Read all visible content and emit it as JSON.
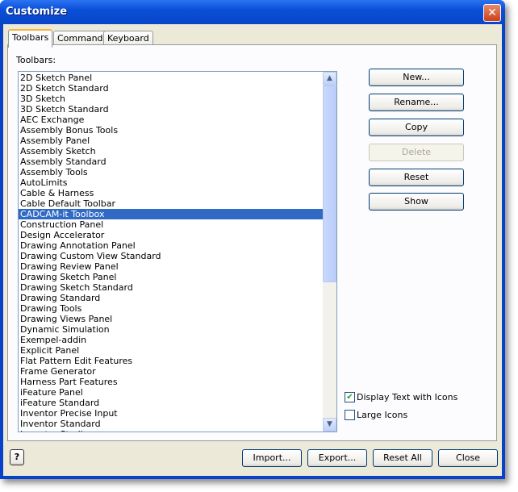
{
  "window": {
    "title": "Customize",
    "close_icon": "close-icon"
  },
  "tabs": [
    {
      "label": "Toolbars"
    },
    {
      "label": "Commands"
    },
    {
      "label": "Keyboard"
    }
  ],
  "list_label": "Toolbars:",
  "toolbars": [
    "2D Sketch Panel",
    "2D Sketch Standard",
    "3D Sketch",
    "3D Sketch Standard",
    "AEC Exchange",
    "Assembly Bonus Tools",
    "Assembly Panel",
    "Assembly Sketch",
    "Assembly Standard",
    "Assembly Tools",
    "AutoLimits",
    "Cable & Harness",
    "Cable Default Toolbar",
    "CADCAM-it Toolbox",
    "Construction Panel",
    "Design Accelerator",
    "Drawing Annotation Panel",
    "Drawing Custom View Standard",
    "Drawing Review Panel",
    "Drawing Sketch Panel",
    "Drawing Sketch Standard",
    "Drawing Standard",
    "Drawing Tools",
    "Drawing Views Panel",
    "Dynamic Simulation",
    "Exempel-addin",
    "Explicit Panel",
    "Flat Pattern Edit Features",
    "Frame Generator",
    "Harness Part Features",
    "iFeature Panel",
    "iFeature Standard",
    "Inventor Precise Input",
    "Inventor Standard",
    "Inventor Studio"
  ],
  "selected_toolbar": "CADCAM-it Toolbox",
  "side_buttons": {
    "new": "New...",
    "rename": "Rename...",
    "copy": "Copy",
    "delete": "Delete",
    "reset": "Reset",
    "show": "Show"
  },
  "options": {
    "display_text_label": "Display Text with Icons",
    "display_text_checked": true,
    "large_icons_label": "Large Icons",
    "large_icons_checked": false
  },
  "bottom_buttons": {
    "import": "Import...",
    "export": "Export...",
    "reset_all": "Reset All",
    "close": "Close"
  },
  "help_icon": "?"
}
